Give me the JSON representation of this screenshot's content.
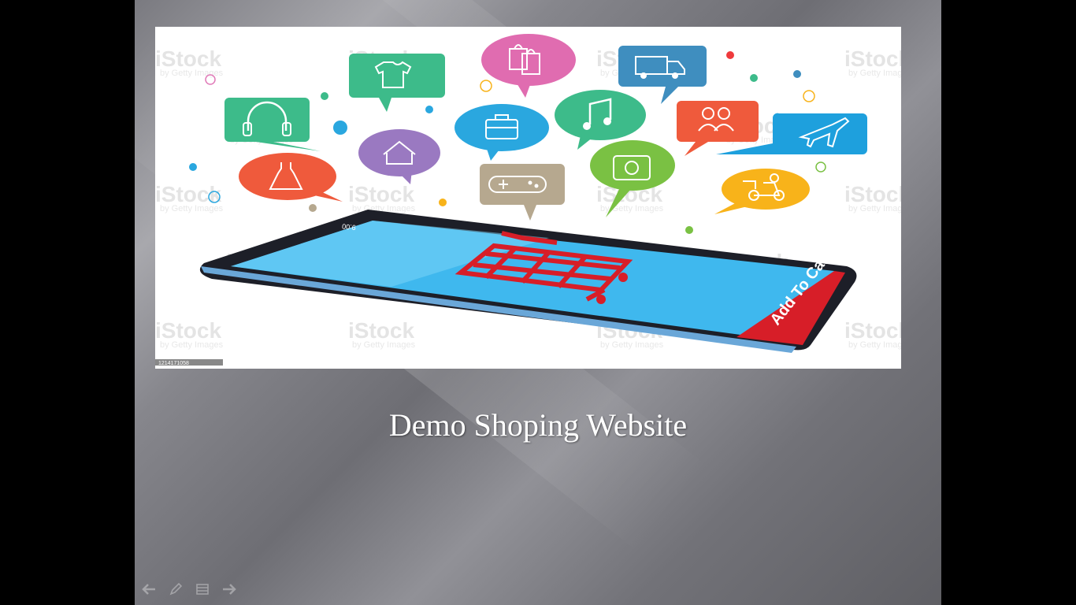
{
  "slide": {
    "title": "Demo Shoping Website"
  },
  "hero_image": {
    "watermark_text": "iStock",
    "watermark_subtext": "by Getty Images",
    "stock_id": "1214171058",
    "phone_time": "9:00",
    "cart_button_label": "Add To Cart",
    "icons": [
      "shirt-icon",
      "shopping-bags-icon",
      "delivery-truck-icon",
      "headphones-icon",
      "briefcase-icon",
      "music-note-icon",
      "people-icon",
      "airplane-icon",
      "house-icon",
      "dress-icon",
      "gamepad-icon",
      "camera-icon",
      "delivery-scooter-icon",
      "shopping-cart-icon"
    ]
  },
  "nav": {
    "prev_icon": "arrow-left-icon",
    "pen_icon": "pen-icon",
    "menu_icon": "slide-menu-icon",
    "next_icon": "arrow-right-icon"
  },
  "colors": {
    "cart_red": "#d71e28",
    "screen_blue": "#3fb8ee",
    "bubble_green": "#3dbb8a",
    "bubble_pink": "#e06cb0",
    "bubble_steelblue": "#3f8ebf",
    "bubble_orange": "#ef5a3c",
    "bubble_sky": "#2aa7df",
    "bubble_purple": "#9a79c1",
    "bubble_tan": "#b6a88f",
    "bubble_lime": "#7ac143",
    "bubble_yellow": "#f8b31a",
    "bubble_blue": "#1ea0dd"
  }
}
